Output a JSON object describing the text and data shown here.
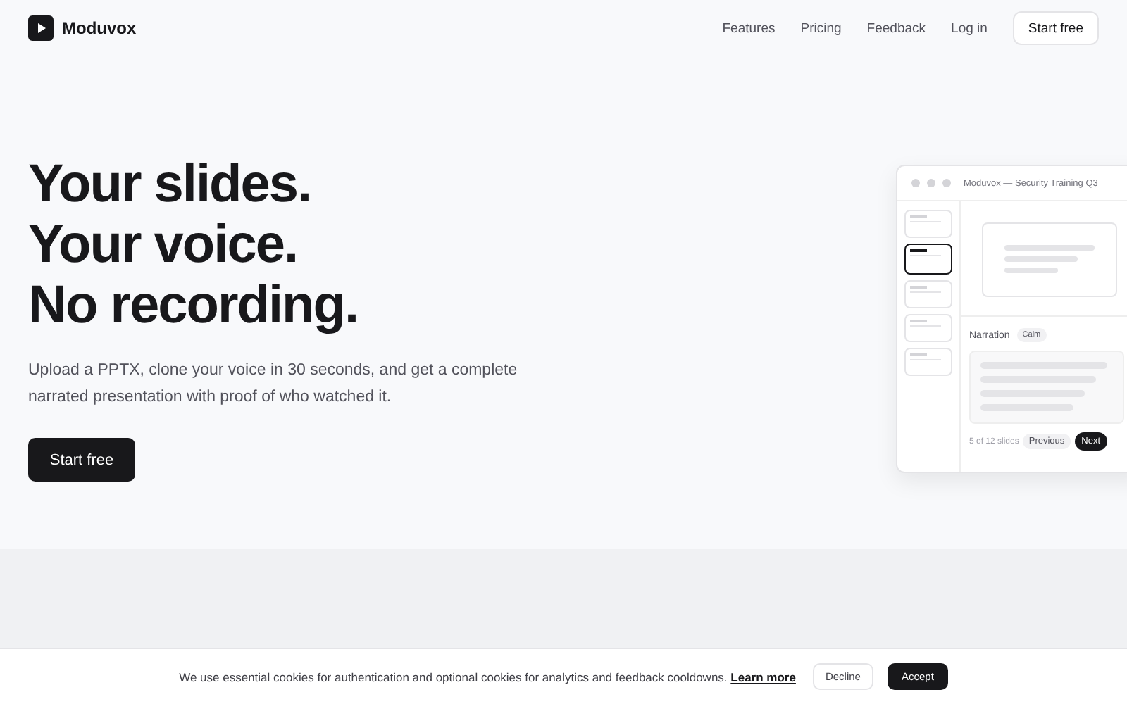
{
  "nav": {
    "brand": "Moduvox",
    "links": [
      "Features",
      "Pricing",
      "Feedback",
      "Log in"
    ],
    "cta": "Start free"
  },
  "hero": {
    "title_lines": [
      "Your slides.",
      "Your voice.",
      "No recording."
    ],
    "subtitle": "Upload a PPTX, clone your voice in 30 seconds, and get a complete narrated presentation with proof of who watched it.",
    "cta": "Start free"
  },
  "preview": {
    "title": "Moduvox — Security Training Q3",
    "thumbnails": [
      {
        "selected": false
      },
      {
        "selected": true
      },
      {
        "selected": false
      },
      {
        "selected": false
      },
      {
        "selected": false
      }
    ],
    "narration_label": "Narration",
    "tone": "Calm",
    "progress": "5 of 12 slides",
    "previous": "Previous",
    "next": "Next"
  },
  "cookie_banner": {
    "text": "We use essential cookies for authentication and optional cookies for analytics and feedback cooldowns.",
    "link": "Learn more",
    "decline": "Decline",
    "accept": "Accept"
  }
}
